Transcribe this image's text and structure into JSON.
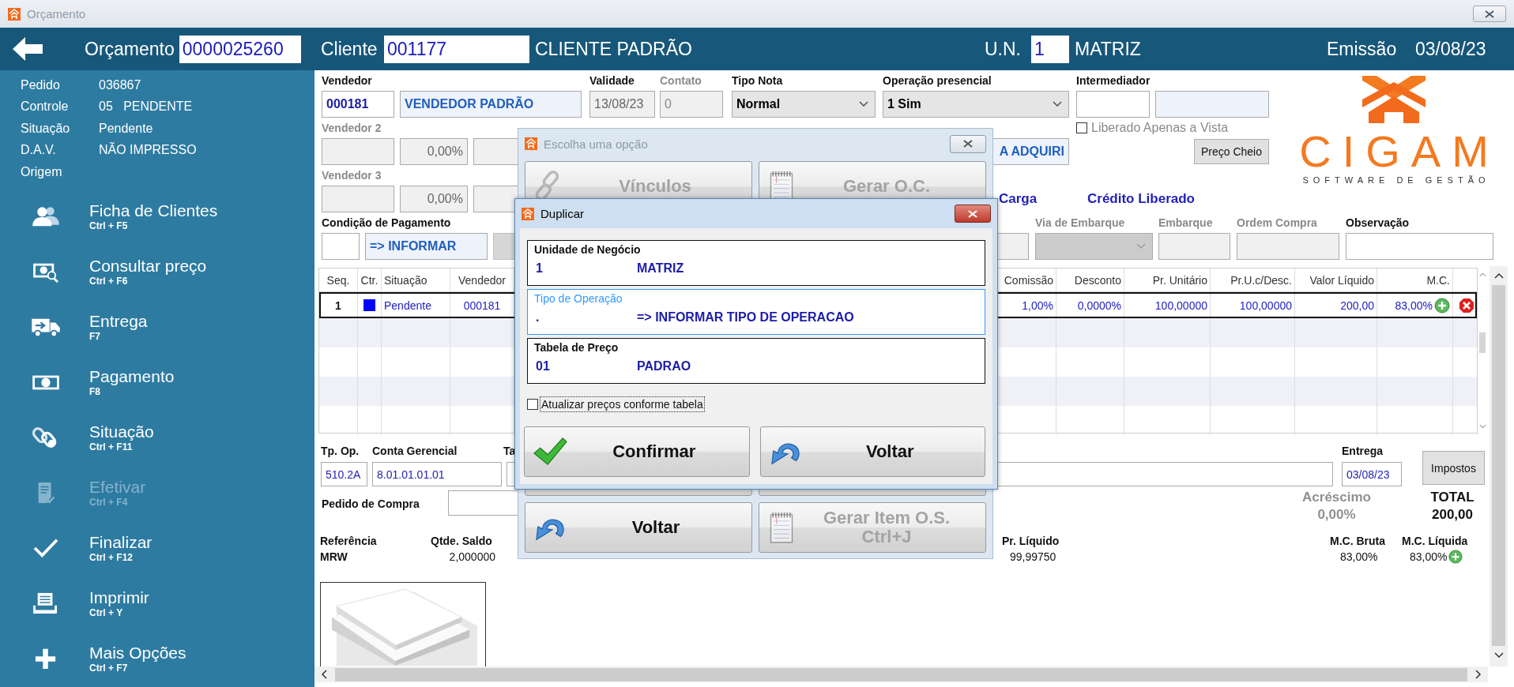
{
  "window": {
    "title": "Orçamento"
  },
  "header": {
    "orcamento_label": "Orçamento",
    "orcamento": "0000025260",
    "cliente_label": "Cliente",
    "cliente_code": "001177",
    "cliente_name": "CLIENTE PADRÃO",
    "un_label": "U.N.",
    "un_code": "1",
    "un_name": "MATRIZ",
    "emissao_label": "Emissão",
    "emissao": "03/08/23"
  },
  "sidebar": {
    "info": [
      {
        "label": "Pedido",
        "value": "036867"
      },
      {
        "label": "Controle",
        "value": "05   PENDENTE"
      },
      {
        "label": "Situação",
        "value": "Pendente"
      },
      {
        "label": "D.A.V.",
        "value": "NÃO IMPRESSO"
      },
      {
        "label": "Origem"
      }
    ],
    "items": [
      {
        "label": "Ficha de Clientes",
        "shortcut": "Ctrl + F5",
        "disabled": false
      },
      {
        "label": "Consultar preço",
        "shortcut": "Ctrl + F6",
        "disabled": false
      },
      {
        "label": "Entrega",
        "shortcut": "F7",
        "disabled": false
      },
      {
        "label": "Pagamento",
        "shortcut": "F8",
        "disabled": false
      },
      {
        "label": "Situação",
        "shortcut": "Ctrl + F11",
        "disabled": false
      },
      {
        "label": "Efetivar",
        "shortcut": "Ctrl + F4",
        "disabled": true
      },
      {
        "label": "Finalizar",
        "shortcut": "Ctrl + F12",
        "disabled": false
      },
      {
        "label": "Imprimir",
        "shortcut": "Ctrl + Y",
        "disabled": false
      },
      {
        "label": "Mais Opções",
        "shortcut": "Ctrl + F7",
        "disabled": false
      }
    ]
  },
  "form": {
    "vendedor": {
      "label": "Vendedor",
      "code": "000181",
      "name": "VENDEDOR PADRÃO",
      "disabled": false
    },
    "validade": {
      "label": "Validade",
      "value": "13/08/23",
      "disabled": false
    },
    "contato": {
      "label": "Contato",
      "value": "0",
      "disabled": true
    },
    "tipo_nota": {
      "label": "Tipo Nota",
      "value": "Normal",
      "disabled": false
    },
    "operacao_presencial": {
      "label": "Operação presencial",
      "value": "1 Sim",
      "disabled": false
    },
    "intermediador": {
      "label": "Intermediador",
      "disabled": false
    },
    "liberado_apenas_a_vista": {
      "label": "Liberado Apenas a Vista",
      "checked": false,
      "disabled": true
    },
    "preco_cheio_button": "Preço Cheio",
    "vendedor_2": {
      "label": "Vendedor 2",
      "percent": "0,00%",
      "disabled": true
    },
    "tipo_operacao": {
      "value": "A ADQUIRI"
    },
    "vendedor_3": {
      "label": "Vendedor 3",
      "percent": "0,00%",
      "disabled": true
    },
    "carga_status": "Carga",
    "credito_status": "Crédito Liberado",
    "condicao_pagamento": {
      "label": "Condição de Pagamento",
      "value": "=> INFORMAR",
      "disabled": false
    },
    "via_de_embarque": {
      "label": "Via de Embarque",
      "disabled": true
    },
    "embarque": {
      "label": "Embarque",
      "disabled": true
    },
    "ordem_compra": {
      "label": "Ordem Compra",
      "disabled": true
    },
    "observacao": {
      "label": "Observação",
      "disabled": false
    }
  },
  "logo": {
    "name": "CIGAM",
    "tagline": "SOFTWARE DE GESTÃO"
  },
  "items_table": {
    "columns": [
      "Seq.",
      "Ctr.",
      "Situação",
      "Vendedor",
      "Comissão",
      "Desconto",
      "Pr. Unitário",
      "Pr.U.c/Desc.",
      "Valor Líquido",
      "M.C."
    ],
    "rows": [
      {
        "seq": "1",
        "color": "#0000ff",
        "situacao": "Pendente",
        "vendedor": "000181",
        "comissao": "1,00%",
        "desconto": "0,0000%",
        "pr_unitario": "100,00000",
        "pr_uc_desc": "100,00000",
        "valor_liquido": "200,00",
        "mc": "83,00%",
        "selected": true
      }
    ]
  },
  "bottom": {
    "tp_op": {
      "label": "Tp. Op.",
      "value": "510.2A"
    },
    "conta_gerencial": {
      "label": "Conta Gerencial",
      "value": "8.01.01.01.01"
    },
    "third_field": {
      "label": "Ta"
    },
    "entrega": {
      "label": "Entrega",
      "value": "03/08/23"
    },
    "impostos_button": "Impostos",
    "pedido_de_compra": {
      "label": "Pedido de Compra"
    },
    "acrescimo": {
      "label": "Acréscimo",
      "value": "0,00%"
    },
    "total": {
      "label": "TOTAL",
      "value": "200,00"
    }
  },
  "item_detail": {
    "referencia": {
      "label": "Referência",
      "value": "MRW"
    },
    "qtde_saldo": {
      "label": "Qtde. Saldo",
      "value": "2,000000"
    },
    "pr_liquido": {
      "label": "Pr. Líquido",
      "value": "99,99750"
    },
    "mc_bruta": {
      "label": "M.C. Bruta",
      "value": "83,00%"
    },
    "mc_liquida": {
      "label": "M.C. Líquida",
      "value": "83,00%"
    }
  },
  "options_dialog": {
    "title": "Escolha uma opção",
    "active": false,
    "buttons": [
      {
        "label": "Vínculos",
        "disabled": true
      },
      {
        "label": "Gerar O.C.",
        "disabled": true
      },
      {
        "label": "Voltar",
        "disabled": false
      },
      {
        "label": "Gerar Item O.S.",
        "shortcut": "Ctrl+J",
        "disabled": true
      }
    ]
  },
  "duplicate_dialog": {
    "title": "Duplicar",
    "active": true,
    "groups": [
      {
        "title": "Unidade de Negócio",
        "code": "1",
        "name": "MATRIZ",
        "focused": false
      },
      {
        "title": "Tipo de Operação",
        "code": ".",
        "name": "=> INFORMAR TIPO DE OPERACAO",
        "focused": true
      },
      {
        "title": "Tabela de Preço",
        "code": "01",
        "name": "PADRAO",
        "focused": false
      }
    ],
    "update_prices": {
      "label": "Atualizar preços conforme tabela",
      "checked": false
    },
    "buttons": [
      {
        "label": "Confirmar"
      },
      {
        "label": "Voltar"
      }
    ]
  }
}
